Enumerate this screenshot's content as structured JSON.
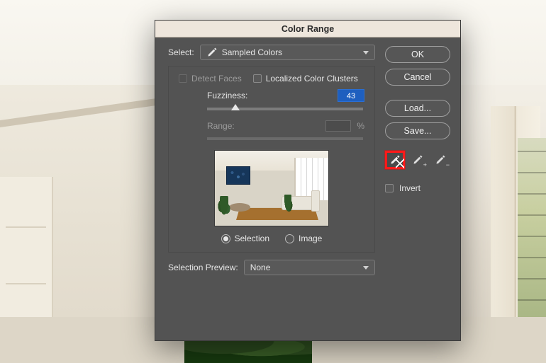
{
  "dialog": {
    "title": "Color Range",
    "select": {
      "label": "Select:",
      "value": "Sampled Colors"
    },
    "detect_faces": {
      "label": "Detect Faces",
      "checked": false,
      "enabled": false
    },
    "localized": {
      "label": "Localized Color Clusters",
      "checked": false
    },
    "fuzziness": {
      "label": "Fuzziness:",
      "value": "43",
      "handle_pct": 18
    },
    "range": {
      "label": "Range:",
      "value": "",
      "unit": "%",
      "enabled": false
    },
    "view_mode": {
      "options": [
        {
          "label": "Selection",
          "checked": true
        },
        {
          "label": "Image",
          "checked": false
        }
      ]
    },
    "selection_preview": {
      "label": "Selection Preview:",
      "value": "None"
    },
    "buttons": {
      "ok": "OK",
      "cancel": "Cancel",
      "load": "Load...",
      "save": "Save..."
    },
    "eyedroppers": {
      "sample": "eyedropper",
      "add": "eyedropper-add",
      "subtract": "eyedropper-subtract",
      "selected": "sample"
    },
    "invert": {
      "label": "Invert",
      "checked": false
    }
  }
}
